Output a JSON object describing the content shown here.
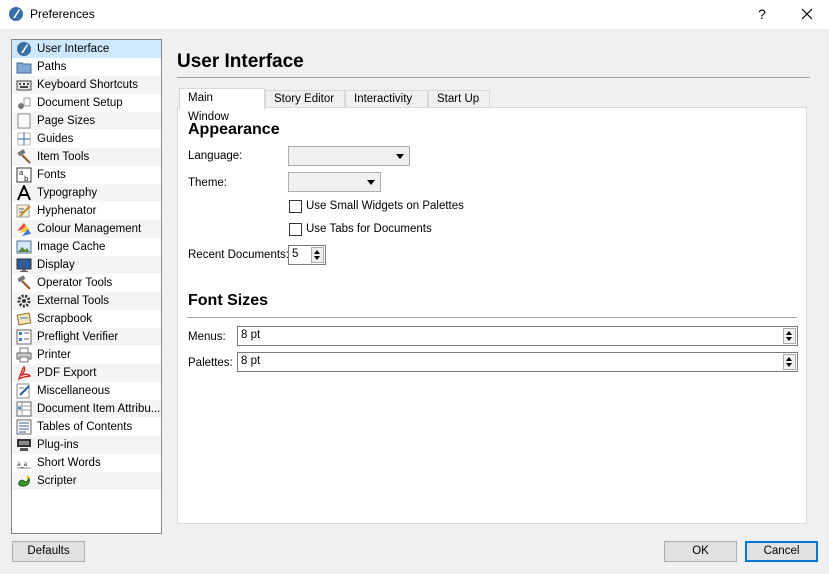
{
  "window": {
    "title": "Preferences",
    "help_glyph": "?"
  },
  "sidebar": {
    "items": [
      {
        "label": "User Interface",
        "icon": "user-interface-icon"
      },
      {
        "label": "Paths",
        "icon": "folder-icon"
      },
      {
        "label": "Keyboard Shortcuts",
        "icon": "keyboard-icon"
      },
      {
        "label": "Document Setup",
        "icon": "document-setup-icon"
      },
      {
        "label": "Page Sizes",
        "icon": "page-icon"
      },
      {
        "label": "Guides",
        "icon": "guides-icon"
      },
      {
        "label": "Item Tools",
        "icon": "hammer-icon"
      },
      {
        "label": "Fonts",
        "icon": "fonts-icon"
      },
      {
        "label": "Typography",
        "icon": "typography-icon"
      },
      {
        "label": "Hyphenator",
        "icon": "hyphenator-icon"
      },
      {
        "label": "Colour Management",
        "icon": "colour-icon"
      },
      {
        "label": "Image Cache",
        "icon": "image-icon"
      },
      {
        "label": "Display",
        "icon": "monitor-icon"
      },
      {
        "label": "Operator Tools",
        "icon": "wrench-icon"
      },
      {
        "label": "External Tools",
        "icon": "gear-icon"
      },
      {
        "label": "Scrapbook",
        "icon": "scrapbook-icon"
      },
      {
        "label": "Preflight Verifier",
        "icon": "checklist-icon"
      },
      {
        "label": "Printer",
        "icon": "printer-icon"
      },
      {
        "label": "PDF Export",
        "icon": "pdf-icon"
      },
      {
        "label": "Miscellaneous",
        "icon": "misc-icon"
      },
      {
        "label": "Document Item Attribu...",
        "icon": "attributes-icon"
      },
      {
        "label": "Tables of Contents",
        "icon": "toc-icon"
      },
      {
        "label": "Plug-ins",
        "icon": "plugin-icon"
      },
      {
        "label": "Short Words",
        "icon": "short-words-icon"
      },
      {
        "label": "Scripter",
        "icon": "scripter-icon"
      }
    ]
  },
  "main": {
    "title": "User Interface",
    "tabs": [
      "Main Window",
      "Story Editor",
      "Interactivity",
      "Start Up"
    ],
    "appearance": {
      "heading": "Appearance",
      "language_label": "Language:",
      "language_value": "",
      "theme_label": "Theme:",
      "theme_value": "",
      "small_widgets_label": "Use Small Widgets on Palettes",
      "small_widgets_checked": false,
      "tabs_for_docs_label": "Use Tabs for Documents",
      "tabs_for_docs_checked": false,
      "recent_docs_label": "Recent Documents:",
      "recent_docs_value": "5"
    },
    "font_sizes": {
      "heading": "Font Sizes",
      "menus_label": "Menus:",
      "menus_value": "8 pt",
      "palettes_label": "Palettes:",
      "palettes_value": "8 pt"
    }
  },
  "buttons": {
    "defaults": "Defaults",
    "ok": "OK",
    "cancel": "Cancel"
  },
  "colors": {
    "selection": "#cde8ff",
    "default_button_border": "#0078d7"
  }
}
